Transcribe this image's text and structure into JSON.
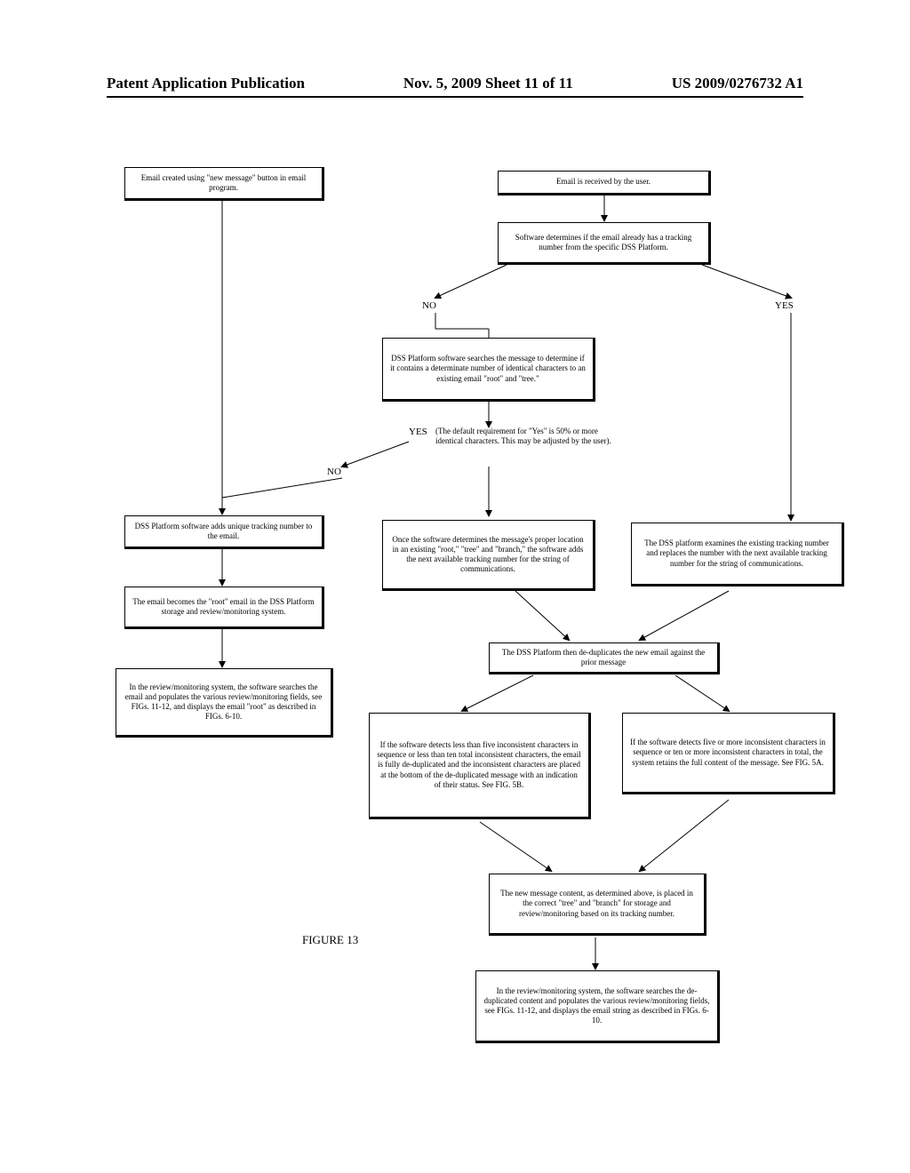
{
  "header": {
    "left": "Patent Application Publication",
    "center": "Nov. 5, 2009  Sheet 11 of 11",
    "right": "US 2009/0276732 A1"
  },
  "figure_label": "FIGURE 13",
  "labels": {
    "no1": "NO",
    "yes1": "YES",
    "no2": "NO",
    "yes2": "YES",
    "yes2_note": "(The default requirement for \"Yes\" is 50% or more identical characters. This may be adjusted by the user)."
  },
  "boxes": {
    "start_left": "Email created using \"new message\" button in email program.",
    "start_right": "Email is received by the user.",
    "check_tracking": "Software determines if the email already has a tracking number from the specific DSS Platform.",
    "search_chars": "DSS Platform software searches the message to determine if it contains a determinate number of identical characters to an existing email \"root\" and \"tree.\"",
    "add_unique": "DSS Platform software adds unique tracking number to the email.",
    "becomes_root": "The email becomes the \"root\" email in the DSS Platform storage and review/monitoring system.",
    "review_root": "In the review/monitoring system, the software searches the email and populates the various review/monitoring fields, see FIGs. 11-12, and displays the email \"root\" as described in FIGs. 6-10.",
    "proper_location": "Once the software determines the message's proper location in an existing \"root,\" \"tree\" and \"branch,\" the software adds the next available tracking number for the string of communications.",
    "examines_existing": "The DSS platform examines the existing tracking number and replaces the number with the next available tracking number for the string of communications.",
    "dedup": "The DSS Platform then de-duplicates the new email against the prior message",
    "dedup_left": "If the software detects less than five inconsistent characters in sequence or less than ten total inconsistent characters, the email is fully de-duplicated and the inconsistent characters are placed at the bottom of the de-duplicated message with an indication of their status. See FIG. 5B.",
    "dedup_right": "If the software detects five or more inconsistent characters in sequence or ten or more inconsistent characters in total, the system retains the full content of the message. See FIG. 5A.",
    "placed": "The new message content, as determined above, is placed in the correct \"tree\" and \"branch\" for storage and review/monitoring based on its tracking number.",
    "final_review": "In the review/monitoring system, the software searches the de-duplicated content and populates the various review/monitoring fields, see FIGs. 11-12, and displays the email string as described in FIGs. 6-10."
  }
}
